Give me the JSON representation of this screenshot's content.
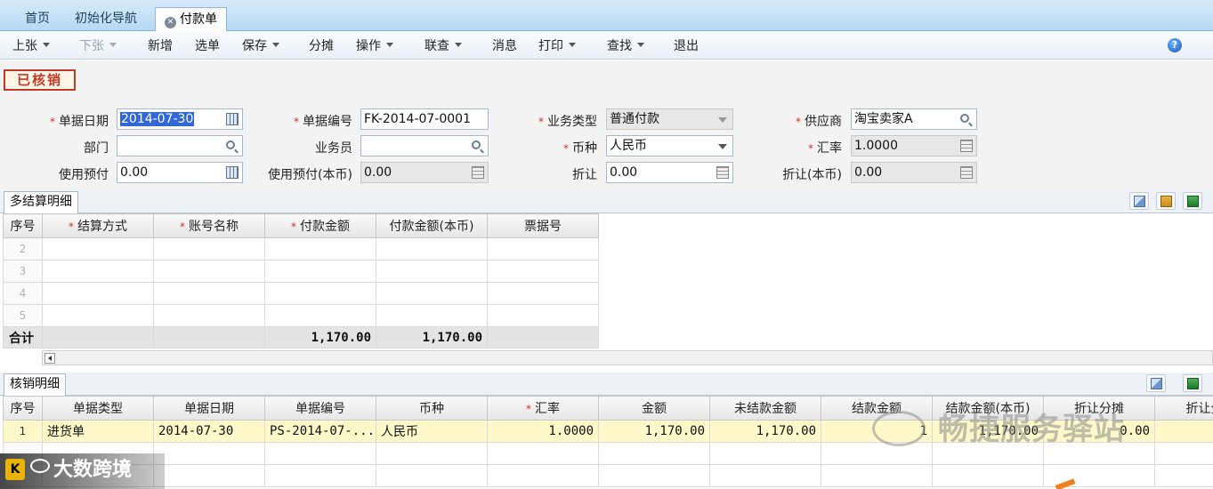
{
  "tabs": [
    {
      "label": "首页"
    },
    {
      "label": "初始化导航"
    },
    {
      "label": "付款单"
    }
  ],
  "toolbar": {
    "items": [
      {
        "label": "上张",
        "dropdown": true,
        "disabled": false
      },
      {
        "label": "下张",
        "dropdown": true,
        "disabled": true
      },
      {
        "label": "新增",
        "dropdown": false,
        "disabled": false
      },
      {
        "label": "选单",
        "dropdown": false,
        "disabled": false
      },
      {
        "label": "保存",
        "dropdown": true,
        "disabled": false
      },
      {
        "label": "分摊",
        "dropdown": false,
        "disabled": false
      },
      {
        "label": "操作",
        "dropdown": true,
        "disabled": false
      },
      {
        "label": "联查",
        "dropdown": true,
        "disabled": false
      },
      {
        "label": "消息",
        "dropdown": false,
        "disabled": false
      },
      {
        "label": "打印",
        "dropdown": true,
        "disabled": false
      },
      {
        "label": "查找",
        "dropdown": true,
        "disabled": false
      },
      {
        "label": "退出",
        "dropdown": false,
        "disabled": false
      }
    ],
    "help_icon": "help-icon"
  },
  "status_stamp": "已核销",
  "form": {
    "doc_date_label": "单据日期",
    "doc_date_value": "2014-07-30",
    "doc_no_label": "单据编号",
    "doc_no_value": "FK-2014-07-0001",
    "biz_type_label": "业务类型",
    "biz_type_value": "普通付款",
    "supplier_label": "供应商",
    "supplier_value": "淘宝卖家A",
    "dept_label": "部门",
    "dept_value": "",
    "staff_label": "业务员",
    "staff_value": "",
    "currency_label": "币种",
    "currency_value": "人民币",
    "rate_label": "汇率",
    "rate_value": "1.0000",
    "prepay_label": "使用预付",
    "prepay_value": "0.00",
    "prepay_local_label": "使用预付(本币)",
    "prepay_local_value": "0.00",
    "discount_label": "折让",
    "discount_value": "0.00",
    "discount_local_label": "折让(本币)",
    "discount_local_value": "0.00"
  },
  "settlement": {
    "tab_label": "多结算明细",
    "columns": [
      "序号",
      "结算方式",
      "账号名称",
      "付款金额",
      "付款金额(本币)",
      "票据号"
    ],
    "required_columns": [
      1,
      2,
      3
    ],
    "row_numbers": [
      "2",
      "3",
      "4",
      "5"
    ],
    "total_label": "合计",
    "total_amount": "1,170.00",
    "total_amount_local": "1,170.00"
  },
  "writeoff": {
    "tab_label": "核销明细",
    "columns": [
      "序号",
      "单据类型",
      "单据日期",
      "单据编号",
      "币种",
      "汇率",
      "金额",
      "未结款金额",
      "结款金额",
      "结款金额(本币)",
      "折让分摊",
      "折让分摊"
    ],
    "required_columns": [
      5
    ],
    "rows": [
      {
        "no": "1",
        "type": "进货单",
        "date": "2014-07-30",
        "doc_no": "PS-2014-07-...",
        "currency": "人民币",
        "rate": "1.0000",
        "amount": "1,170.00",
        "unsettled": "1,170.00",
        "settled": "1",
        "settled_local": "1,170.00",
        "discount": "0.00",
        "discount2": ""
      }
    ],
    "empty_rows": [
      "",
      ""
    ]
  },
  "watermarks": {
    "wechat": "畅捷服务驿站",
    "logo": "大数跨境"
  },
  "colors": {
    "tabbar": "#b6d9f5",
    "stamp": "#c0392b",
    "required": "#d0312d",
    "highlight_row": "#fff8c8"
  }
}
